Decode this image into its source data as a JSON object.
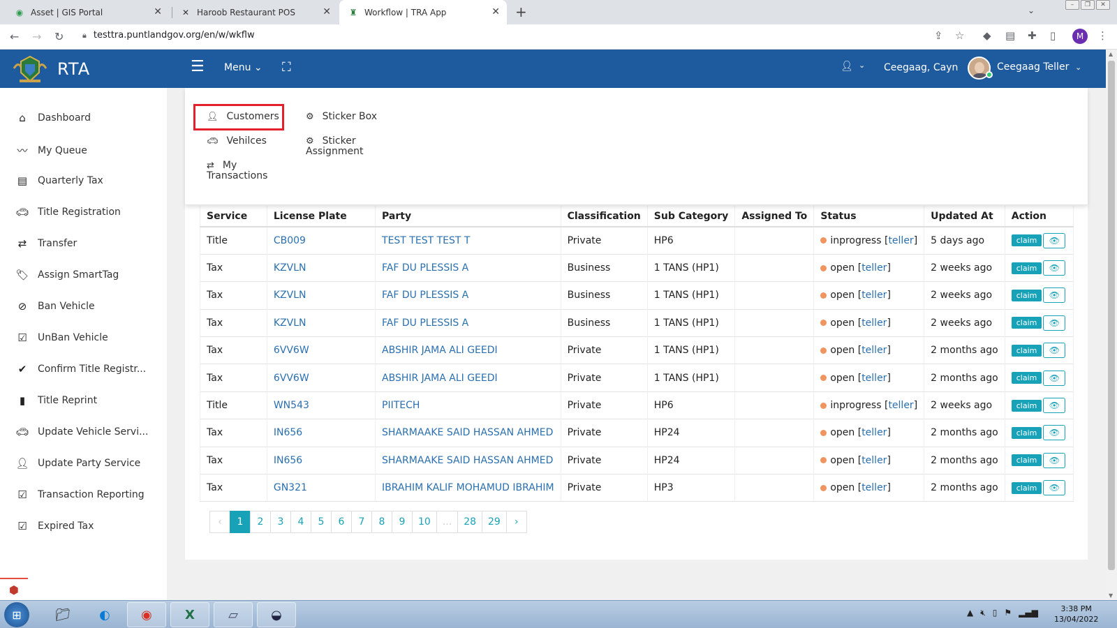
{
  "browser": {
    "tabs": [
      {
        "title": "Asset | GIS Portal",
        "icon": "globe-icon"
      },
      {
        "title": "Haroob Restaurant POS",
        "icon": "x-logo-icon"
      },
      {
        "title": "Workflow | TRA App",
        "icon": "crest-icon"
      }
    ],
    "url": "testtra.puntlandgov.org/en/w/wkflw",
    "profile_initial": "M"
  },
  "header": {
    "brand": "RTA",
    "menu_label": "Menu",
    "user_name": "Ceegaag, Cayn",
    "user_role": "Ceegaag Teller"
  },
  "sidebar": {
    "items": [
      {
        "label": "Dashboard",
        "icon": "home-icon"
      },
      {
        "label": "My Queue",
        "icon": "trend-icon"
      },
      {
        "label": "Quarterly Tax",
        "icon": "list-icon"
      },
      {
        "label": "Title Registration",
        "icon": "car-icon"
      },
      {
        "label": "Transfer",
        "icon": "exchange-icon"
      },
      {
        "label": "Assign SmartTag",
        "icon": "tags-icon"
      },
      {
        "label": "Ban Vehicle",
        "icon": "ban-icon"
      },
      {
        "label": "UnBan Vehicle",
        "icon": "check-square-icon"
      },
      {
        "label": "Confirm Title Registr...",
        "icon": "check-icon"
      },
      {
        "label": "Title Reprint",
        "icon": "file-icon"
      },
      {
        "label": "Update Vehicle Servi...",
        "icon": "car-icon"
      },
      {
        "label": "Update Party Service",
        "icon": "user-icon"
      },
      {
        "label": "Transaction Reporting",
        "icon": "check-square-icon"
      },
      {
        "label": "Expired Tax",
        "icon": "check-square-icon"
      }
    ]
  },
  "megamenu": {
    "items": [
      {
        "label": "Customers",
        "icon": "user-icon"
      },
      {
        "label": "Vehilces",
        "icon": "car-icon"
      },
      {
        "label": "My Transactions",
        "icon": "exchange-icon"
      },
      {
        "label": "Sticker Box",
        "icon": "gear-icon"
      },
      {
        "label": "Sticker Assignment",
        "icon": "gear-icon"
      }
    ]
  },
  "table": {
    "columns": [
      "Service",
      "License Plate",
      "Party",
      "Classification",
      "Sub Category",
      "Assigned To",
      "Status",
      "Updated At",
      "Action"
    ],
    "rows": [
      {
        "service": "Title",
        "plate": "CB009",
        "party": "TEST TEST TEST T",
        "classification": "Private",
        "subcat": "HP6",
        "assigned": "",
        "status": "inprogress",
        "assignee": "teller",
        "updated": "5 days ago"
      },
      {
        "service": "Tax",
        "plate": "KZVLN",
        "party": "FAF DU PLESSIS A",
        "classification": "Business",
        "subcat": "1 TANS (HP1)",
        "assigned": "",
        "status": "open",
        "assignee": "teller",
        "updated": "2 weeks ago"
      },
      {
        "service": "Tax",
        "plate": "KZVLN",
        "party": "FAF DU PLESSIS A",
        "classification": "Business",
        "subcat": "1 TANS (HP1)",
        "assigned": "",
        "status": "open",
        "assignee": "teller",
        "updated": "2 weeks ago"
      },
      {
        "service": "Tax",
        "plate": "KZVLN",
        "party": "FAF DU PLESSIS A",
        "classification": "Business",
        "subcat": "1 TANS (HP1)",
        "assigned": "",
        "status": "open",
        "assignee": "teller",
        "updated": "2 weeks ago"
      },
      {
        "service": "Tax",
        "plate": "6VV6W",
        "party": "ABSHIR JAMA ALI GEEDI",
        "classification": "Private",
        "subcat": "1 TANS (HP1)",
        "assigned": "",
        "status": "open",
        "assignee": "teller",
        "updated": "2 months ago"
      },
      {
        "service": "Tax",
        "plate": "6VV6W",
        "party": "ABSHIR JAMA ALI GEEDI",
        "classification": "Private",
        "subcat": "1 TANS (HP1)",
        "assigned": "",
        "status": "open",
        "assignee": "teller",
        "updated": "2 months ago"
      },
      {
        "service": "Title",
        "plate": "WN543",
        "party": "PIITECH",
        "classification": "Private",
        "subcat": "HP6",
        "assigned": "",
        "status": "inprogress",
        "assignee": "teller",
        "updated": "2 weeks ago"
      },
      {
        "service": "Tax",
        "plate": "IN656",
        "party": "SHARMAAKE SAID HASSAN AHMED",
        "classification": "Private",
        "subcat": "HP24",
        "assigned": "",
        "status": "open",
        "assignee": "teller",
        "updated": "2 months ago"
      },
      {
        "service": "Tax",
        "plate": "IN656",
        "party": "SHARMAAKE SAID HASSAN AHMED",
        "classification": "Private",
        "subcat": "HP24",
        "assigned": "",
        "status": "open",
        "assignee": "teller",
        "updated": "2 months ago"
      },
      {
        "service": "Tax",
        "plate": "GN321",
        "party": "IBRAHIM KALIF MOHAMUD IBRAHIM",
        "classification": "Private",
        "subcat": "HP3",
        "assigned": "",
        "status": "open",
        "assignee": "teller",
        "updated": "2 months ago"
      }
    ],
    "claim_label": "claim"
  },
  "pagination": {
    "prev": "‹",
    "next": "›",
    "pages": [
      "1",
      "2",
      "3",
      "4",
      "5",
      "6",
      "7",
      "8",
      "9",
      "10",
      "...",
      "28",
      "29"
    ],
    "current": "1"
  },
  "taskbar": {
    "time": "3:38 PM",
    "date": "13/04/2022"
  },
  "colors": {
    "header_bg": "#1e5a9e",
    "accent": "#17a2b8",
    "status_dot": "#f0955f",
    "highlight_box": "#e3202c"
  }
}
